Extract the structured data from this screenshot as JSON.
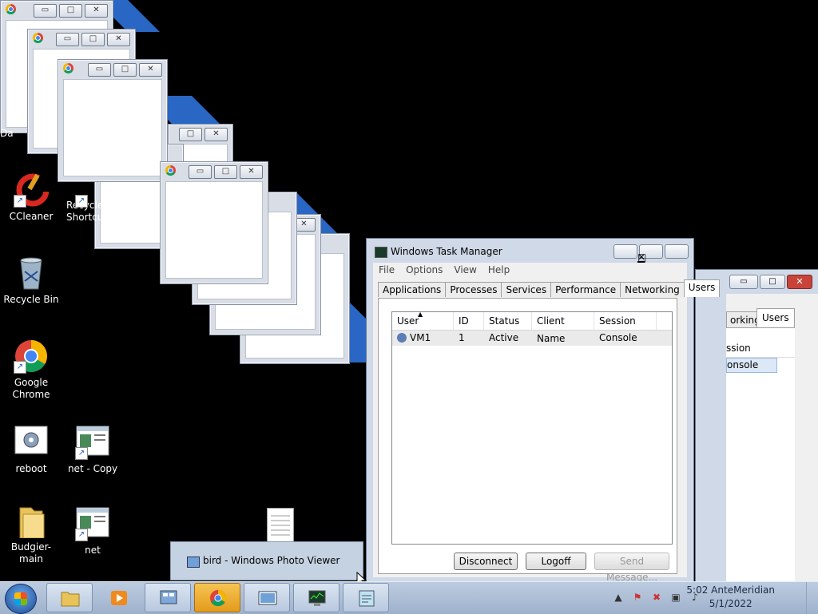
{
  "desktop": {
    "icons": [
      {
        "label": "Da",
        "icon": "folder-partial-icon"
      },
      {
        "label": "CCleaner",
        "icon": "ccleaner-icon"
      },
      {
        "label": "Recycle Shortcut",
        "icon": "recycle-shortcut-icon"
      },
      {
        "label": "Recycle Bin",
        "icon": "recycle-bin-icon"
      },
      {
        "label": "Google Chrome",
        "icon": "chrome-icon"
      },
      {
        "label": "reboot",
        "icon": "reboot-icon"
      },
      {
        "label": "net - Copy",
        "icon": "net-shortcut-icon"
      },
      {
        "label": "Budgier-main",
        "icon": "folder-icon"
      },
      {
        "label": "net",
        "icon": "net-shortcut-icon"
      }
    ]
  },
  "ghost_windows": {
    "min_glyph": "▭",
    "max_glyph": "□",
    "close_glyph": "✕"
  },
  "task_manager": {
    "title": "Windows Task Manager",
    "menu": [
      "File",
      "Options",
      "View",
      "Help"
    ],
    "tabs": [
      "Applications",
      "Processes",
      "Services",
      "Performance",
      "Networking",
      "Users"
    ],
    "active_tab": "Users",
    "columns": [
      "User",
      "ID",
      "Status",
      "Client Name",
      "Session"
    ],
    "rows": [
      {
        "user": "VM1",
        "id": "1",
        "status": "Active",
        "client": "",
        "session": "Console"
      }
    ],
    "buttons": {
      "disconnect": "Disconnect",
      "logoff": "Logoff",
      "send_message": "Send Message..."
    }
  },
  "task_manager_back": {
    "tab_partial": "orking",
    "tab_active": "Users",
    "col_partial": "ssion",
    "cell_partial": "onsole"
  },
  "popup": {
    "label": "bird - Windows Photo Viewer"
  },
  "taskbar": {
    "clock_time": "5:02 AnteMeridian",
    "clock_date": "5/1/2022",
    "tray_up_arrow": "▲"
  }
}
